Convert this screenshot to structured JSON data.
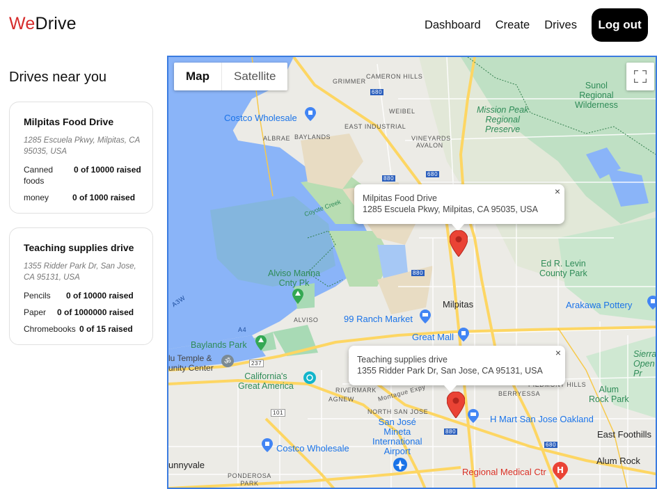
{
  "header": {
    "logo_we": "We",
    "logo_drive": "Drive",
    "nav": [
      "Dashboard",
      "Create",
      "Drives"
    ],
    "logout_label": "Log out"
  },
  "sidebar": {
    "title": "Drives near you",
    "drives": [
      {
        "name": "Milpitas Food Drive",
        "address": "1285 Escuela Pkwy, Milpitas, CA 95035, USA",
        "items": [
          {
            "label": "Canned foods",
            "value": "0 of 10000 raised"
          },
          {
            "label": "money",
            "value": "0 of 1000 raised"
          }
        ]
      },
      {
        "name": "Teaching supplies drive",
        "address": "1355 Ridder Park Dr, San Jose, CA 95131, USA",
        "items": [
          {
            "label": "Pencils",
            "value": "0 of 10000 raised"
          },
          {
            "label": "Paper",
            "value": "0 of 1000000 raised"
          },
          {
            "label": "Chromebooks",
            "value": "0 of 15 raised"
          }
        ]
      }
    ]
  },
  "map": {
    "type_buttons": [
      "Map",
      "Satellite"
    ],
    "active_type": "Map",
    "info_windows": [
      {
        "title": "Milpitas Food Drive",
        "address": "1285 Escuela Pkwy, Milpitas, CA 95035, USA",
        "close": "×"
      },
      {
        "title": "Teaching supplies drive",
        "address": "1355 Ridder Park Dr, San Jose, CA 95131, USA",
        "close": "×"
      }
    ],
    "labels": {
      "grimmer": "GRIMMER",
      "cameron_hills": "CAMERON HILLS",
      "weibel": "WEIBEL",
      "east_industrial": "EAST INDUSTRIAL",
      "albrae": "ALBRAE",
      "baylands": "BAYLANDS",
      "vineyards": "VINEYARDS",
      "avalon": "AVALON",
      "costco1": "Costco Wholesale",
      "sunol": "Sunol\nRegional\nWilderness",
      "mission_peak": "Mission Peak\nRegional\nPreserve",
      "coyote_creek": "Coyote Creek",
      "ed_levin": "Ed R. Levin\nCounty Park",
      "alviso_marina": "Alviso Marina\nCnty Pk",
      "milpitas": "Milpitas",
      "arakawa": "Arakawa Pottery",
      "ranch_market": "99 Ranch Market",
      "alviso": "ALVISO",
      "great_mall": "Great Mall",
      "baylands_park": "Baylands Park",
      "temple": "lu Temple &\nunity Center",
      "california_america": "California's\nGreat America",
      "rivermark": "RIVERMARK",
      "agnew": "AGNEW",
      "montague": "Montague Expy",
      "north_san_jose": "NORTH SAN JOSE",
      "berryessa": "BERRYESSA",
      "piedmont": "PIEDMONT HILLS",
      "alum_rock_park": "Alum\nRock Park",
      "sierra": "Sierra\nOpen S\nPr",
      "airport": "San José\nMineta\nInternational\nAirport",
      "hmart": "H Mart San Jose Oakland",
      "east_foothills": "East Foothills",
      "costco2": "Costco Wholesale",
      "sunnyvale": "unnyvale",
      "alum_rock": "Alum Rock",
      "ponderosa": "PONDEROSA\nPARK",
      "regional_medical": "Regional Medical Ctr",
      "shield_680a": "680",
      "shield_680b": "680",
      "shield_880a": "880",
      "shield_880b": "880",
      "shield_880c": "880",
      "shield_237": "237",
      "shield_101": "101",
      "shield_680c": "680",
      "a3w": "A3W",
      "a4": "A4"
    }
  },
  "colors": {
    "accent": "#d62b2b",
    "water": "#8ab4f8",
    "park": "#a8dab5",
    "highway": "#fdd663",
    "marker": "#ea4335",
    "map_border": "#3a7be0"
  }
}
